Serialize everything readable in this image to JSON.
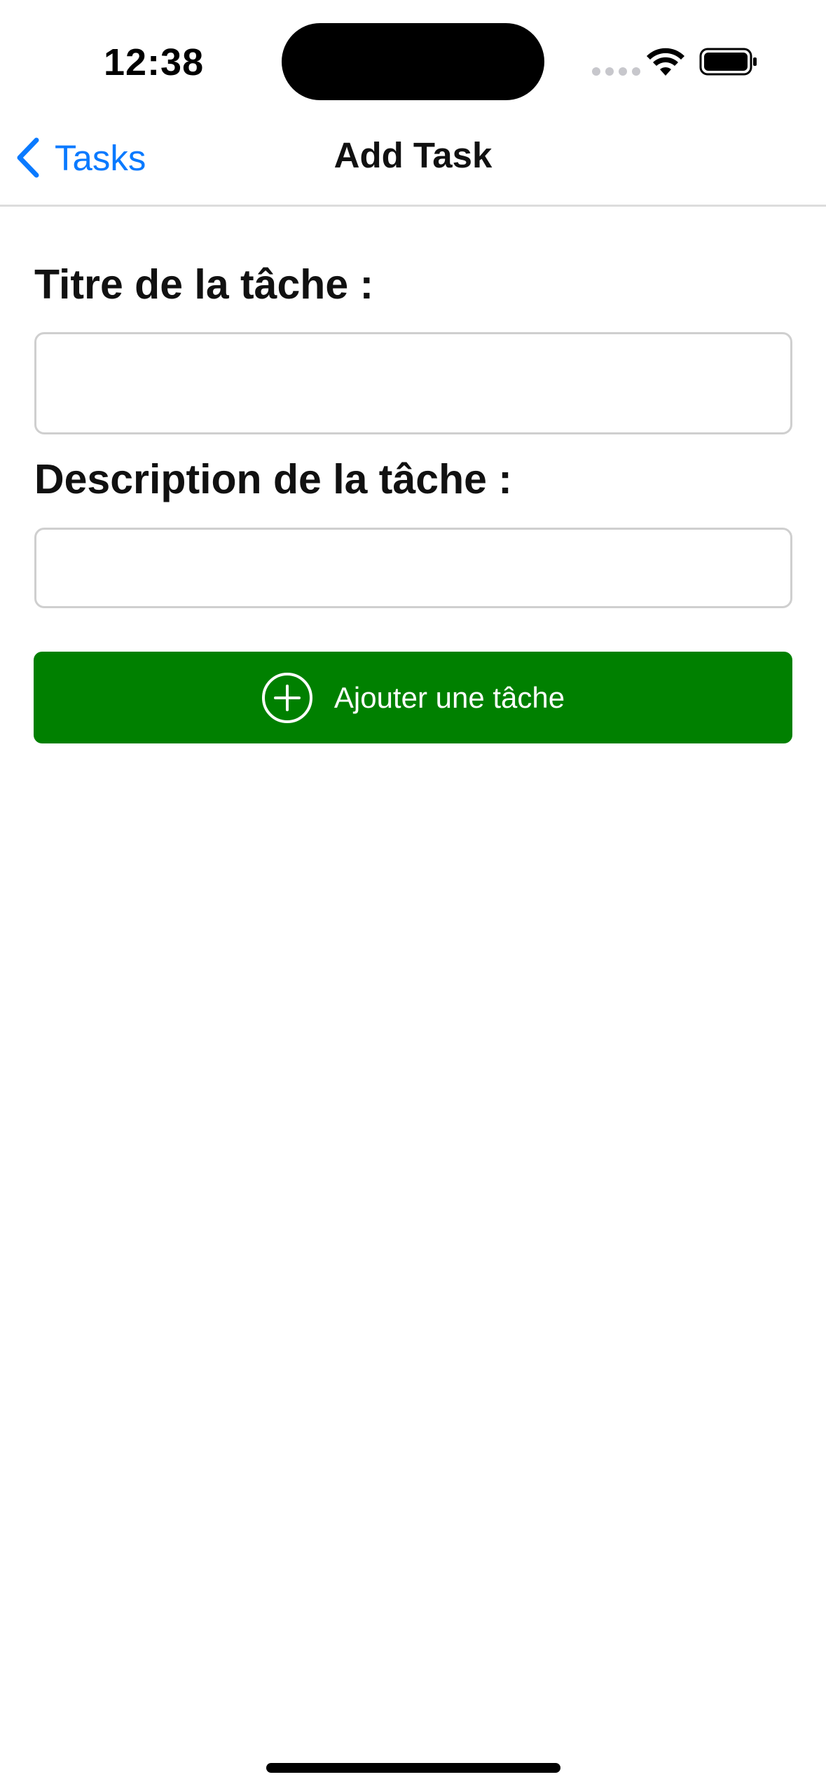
{
  "status_bar": {
    "time": "12:38"
  },
  "nav": {
    "back_label": "Tasks",
    "title": "Add Task"
  },
  "form": {
    "title_label": "Titre de la tâche :",
    "title_value": "",
    "description_label": "Description de la tâche :",
    "description_value": "",
    "submit_label": "Ajouter une tâche",
    "submit_icon": "plus-circle-icon"
  },
  "colors": {
    "accent": "#0a7aff",
    "button_bg": "#008000"
  }
}
